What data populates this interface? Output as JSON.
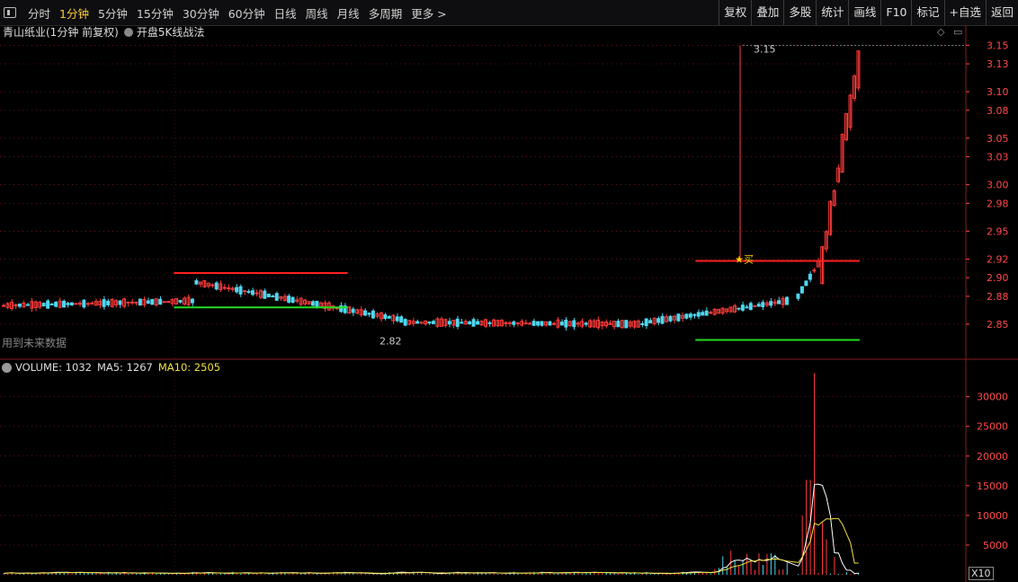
{
  "toolbar": {
    "tabs": [
      "分时",
      "1分钟",
      "5分钟",
      "15分钟",
      "30分钟",
      "60分钟",
      "日线",
      "周线",
      "月线",
      "多周期",
      "更多 >"
    ],
    "active_index": 1,
    "right_buttons": [
      "复权",
      "叠加",
      "多股",
      "统计",
      "画线",
      "F10",
      "标记",
      "+自选",
      "返回"
    ]
  },
  "title": {
    "stock": "青山纸业(1分钟 前复权)",
    "indicator": "开盘5K线战法"
  },
  "note": "用到未来数据",
  "volume_legend": {
    "volume": "VOLUME: 1032",
    "ma5": "MA5: 1267",
    "ma10": "MA10: 2505"
  },
  "x10_label": "X10",
  "colors": {
    "up": "#ff3c3c",
    "down": "#4fd7f0",
    "ma5": "#ffffff",
    "ma10": "#f0e040",
    "grid": "#8a1a1a",
    "axis_text": "#ff4a4a",
    "resistance_line": "#ff2020",
    "support_line": "#22dd22"
  },
  "chart_data": [
    {
      "type": "candlestick",
      "title": "青山纸业(1分钟 前复权)",
      "y_ticks": [
        "3.15",
        "3.13",
        "3.10",
        "3.08",
        "3.05",
        "3.03",
        "3.00",
        "2.98",
        "2.95",
        "2.92",
        "2.90",
        "2.88",
        "2.85"
      ],
      "ylim": [
        2.82,
        3.16
      ],
      "annotations": [
        {
          "text": "3.15",
          "price": 3.15
        },
        {
          "text": "2.82",
          "price": 2.84
        },
        {
          "text": "买",
          "price": 2.92
        }
      ],
      "phases": [
        {
          "bars": 48,
          "start": 2.87,
          "end": 2.875
        },
        {
          "bars": 52,
          "start": 2.895,
          "end": 2.855
        },
        {
          "bars": 60,
          "start": 2.852,
          "end": 2.85
        },
        {
          "bars": 36,
          "start": 2.852,
          "end": 2.875
        },
        {
          "bars": 6,
          "start": 2.88,
          "end": 2.915
        },
        {
          "bars": 10,
          "start": 2.92,
          "end": 3.13
        }
      ],
      "resistance_lines": [
        {
          "price": 2.905,
          "from": 0.18,
          "to": 0.36
        },
        {
          "price": 2.918,
          "from": 0.72,
          "to": 0.89
        }
      ],
      "support_lines": [
        {
          "price": 2.868,
          "from": 0.18,
          "to": 0.36
        },
        {
          "price": 2.833,
          "from": 0.72,
          "to": 0.89
        }
      ]
    },
    {
      "type": "bar",
      "title": "VOLUME",
      "y_ticks": [
        "30000",
        "25000",
        "20000",
        "15000",
        "10000",
        "5000"
      ],
      "ylim": [
        0,
        36000
      ],
      "baseline": 350,
      "spikes": [
        {
          "pos": 0.815,
          "value": 2000
        },
        {
          "pos": 0.821,
          "value": 7000
        },
        {
          "pos": 0.828,
          "value": 10000
        },
        {
          "pos": 0.835,
          "value": 16000
        },
        {
          "pos": 0.842,
          "value": 34000
        },
        {
          "pos": 0.848,
          "value": 9000
        },
        {
          "pos": 0.855,
          "value": 6000
        },
        {
          "pos": 0.862,
          "value": 3000
        }
      ]
    }
  ]
}
